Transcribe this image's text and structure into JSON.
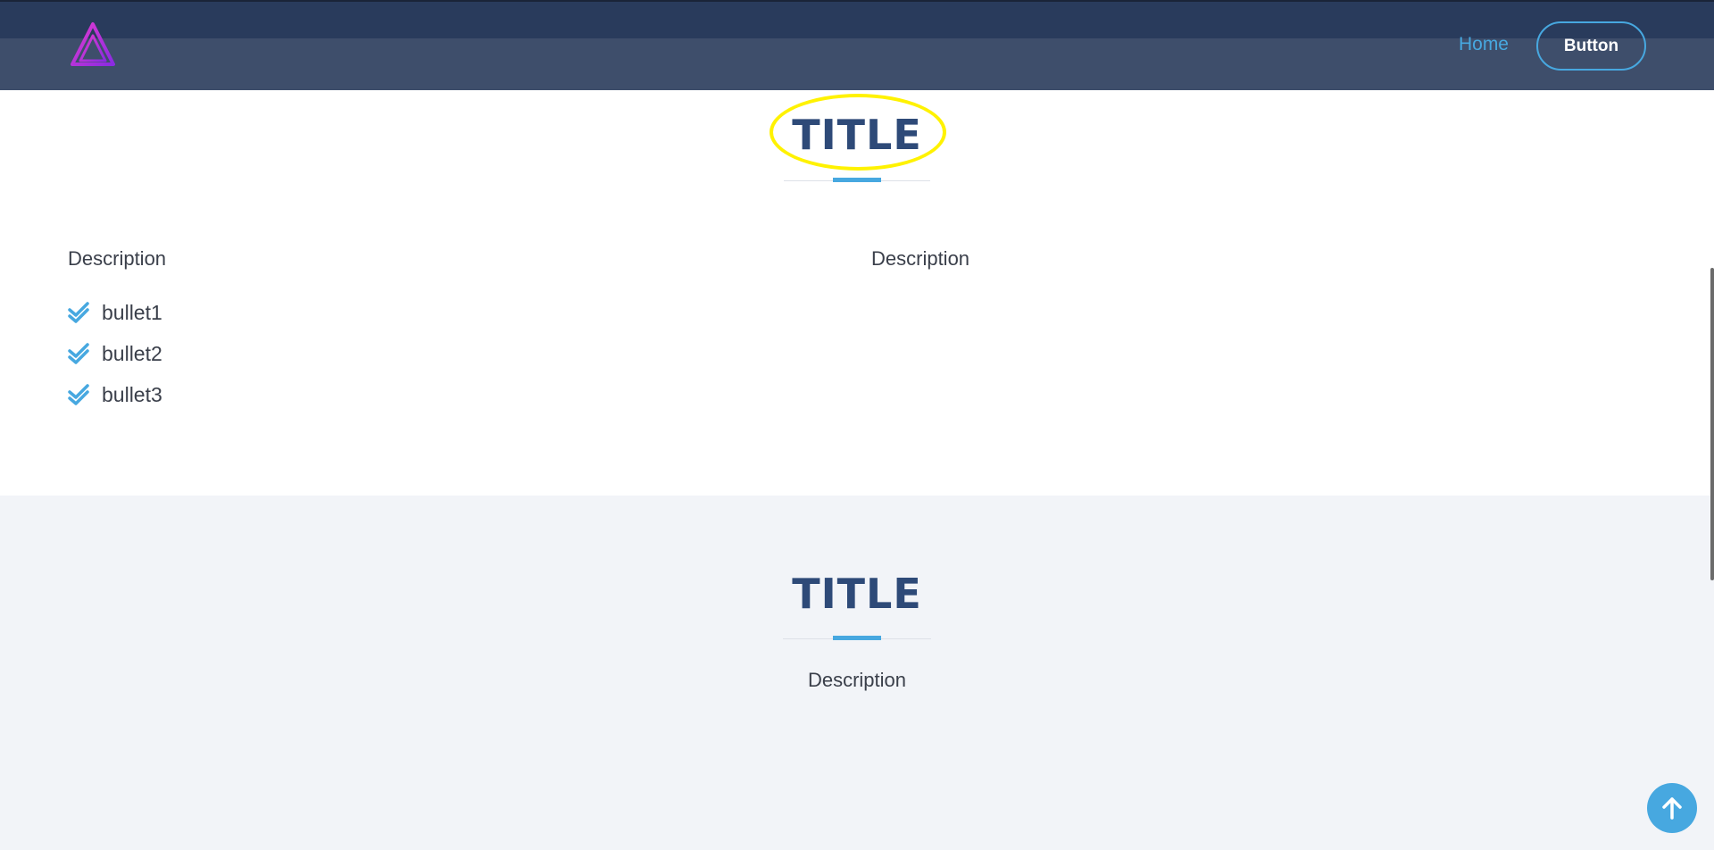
{
  "header": {
    "nav_home": "Home",
    "button_label": "Button",
    "logo_icon": "triangle-a-logo-icon"
  },
  "section1": {
    "title": "TITLE",
    "description_left": "Description",
    "description_right": "Description",
    "bullets": [
      "bullet1",
      "bullet2",
      "bullet3"
    ],
    "bullet_icon": "double-check-icon"
  },
  "section2": {
    "title": "TITLE",
    "description": "Description"
  },
  "back_to_top_icon": "arrow-up-icon",
  "colors": {
    "header_bg": "#3e4e6b",
    "header_top": "#293b5c",
    "accent": "#47a8e0",
    "title": "#2e4a78",
    "highlight": "#fff200",
    "section2_bg": "#f2f4f8",
    "logo_gradient_start": "#e03bd0",
    "logo_gradient_end": "#8a2be2"
  }
}
